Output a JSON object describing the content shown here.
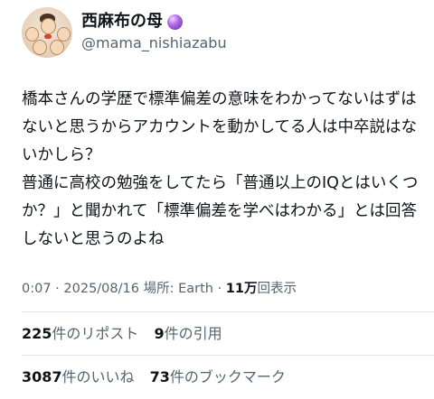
{
  "author": {
    "display_name": "西麻布の母",
    "handle": "@mama_nishiazabu",
    "badge_icon": "crystal-ball-icon"
  },
  "tweet": {
    "paragraphs": [
      "橋本さんの学歴で標準偏差の意味をわかってないはずはないと思うからアカウントを動かしてる人は中卒説はないかしら？",
      "普通に高校の勉強をしてたら「普通以上のIQとはいくつか？」と聞かれて「標準偏差を学べはわかる」とは回答しないと思うのよね"
    ]
  },
  "meta": {
    "time": "0:07",
    "sep1": "·",
    "date": "2025/08/16",
    "location": "場所: Earth",
    "sep2": "·",
    "views_count": "11万",
    "views_label": "回表示"
  },
  "stats": {
    "reposts_count": "225",
    "reposts_label": "件のリポスト",
    "quotes_count": "9",
    "quotes_label": "件の引用",
    "likes_count": "3087",
    "likes_label": "件のいいね",
    "bookmarks_count": "73",
    "bookmarks_label": "件のブックマーク"
  },
  "colors": {
    "text_primary": "#0f1419",
    "text_secondary": "#536471",
    "divider": "#e6e9ec",
    "badge": "#8e44c9"
  }
}
